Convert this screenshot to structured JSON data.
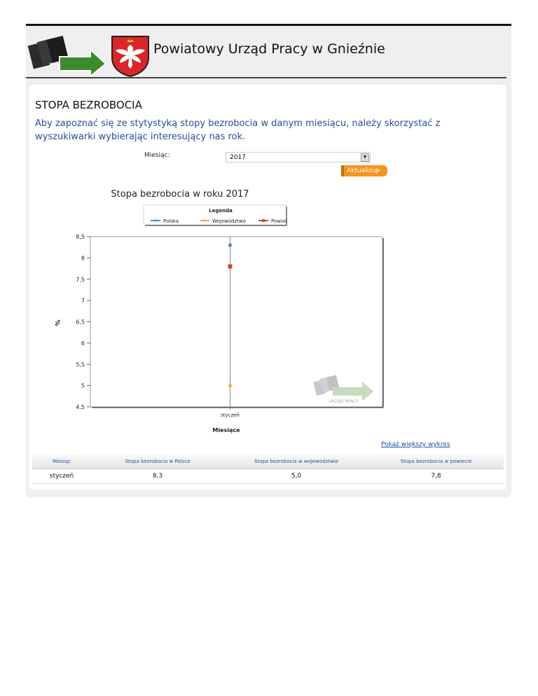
{
  "header": {
    "site_title": "Powiatowy Urząd Pracy w Gnieźnie"
  },
  "page": {
    "title": "STOPA BEZROBOCIA",
    "intro": "Aby zapoznać się ze stytystyką stopy bezrobocia w danym miesiącu, należy skorzystać z wyszukiwarki wybierając interesujący nas rok."
  },
  "form": {
    "month_label": "Miesiąc:",
    "year_value": "2017",
    "update_label": "Aktualizuj",
    "update_arrow": ">"
  },
  "chart_data": {
    "type": "scatter",
    "title": "Stopa bezrobocia w roku 2017",
    "legend_title": "Legenda",
    "legend_position": "top",
    "xlabel": "Miesiące",
    "ylabel": "%",
    "categories": [
      "styczeń"
    ],
    "ylim": [
      4.5,
      8.5
    ],
    "yticks": [
      "8,5",
      "8",
      "7,5",
      "7",
      "6,5",
      "6",
      "5,5",
      "5",
      "4,5"
    ],
    "grid": "x",
    "watermark": "URZĄD PRACY",
    "series": [
      {
        "name": "Polska",
        "values": [
          8.3
        ],
        "color": "#4a8fd4",
        "marker": "circle"
      },
      {
        "name": "Województwo",
        "values": [
          5.0
        ],
        "color": "#f5b040",
        "marker": "circle"
      },
      {
        "name": "Powiat",
        "values": [
          7.8
        ],
        "color": "#c0501c",
        "marker": "square"
      }
    ]
  },
  "links": {
    "bigger_chart": "Pokaż większy wykres"
  },
  "table": {
    "headers": [
      "Miesiąc",
      "Stopa bezrobocia w Polsce",
      "Stopa bezrobocia w województwie",
      "Stopa bezrobocia w powiecie"
    ],
    "rows": [
      [
        "styczeń",
        "8,3",
        "5,0",
        "7,8"
      ]
    ]
  },
  "colors": {
    "link": "#1f4f9e",
    "accent": "#f7941d",
    "arrow_green": "#3f8a2c"
  }
}
